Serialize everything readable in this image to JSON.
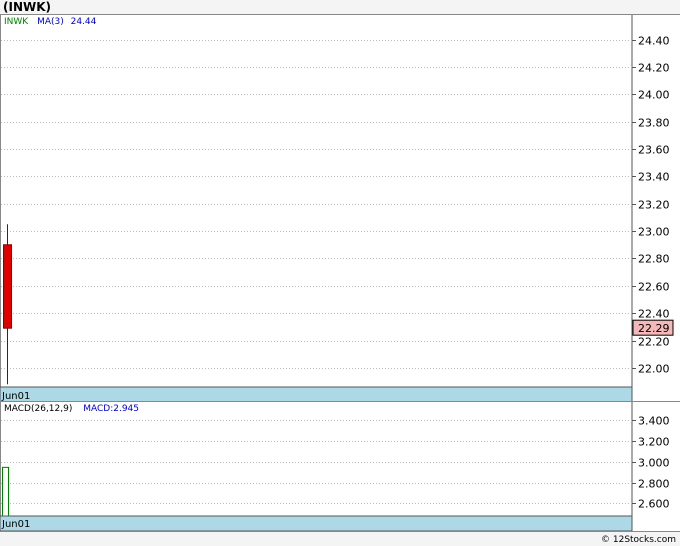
{
  "header": {
    "title": "(INWK)"
  },
  "price_panel": {
    "legend_symbol": "INWK",
    "legend_ma_label": "MA(3)",
    "legend_ma_value": "24.44",
    "last_price": "22.29",
    "date_label": "Jun01",
    "colors": {
      "down_candle": "#e00000",
      "price_badge": "#f4b8b8",
      "date_bar": "#add8e6",
      "grid": "#bbbbbb",
      "symbol": "#008000",
      "ma": "#0000cc"
    }
  },
  "macd_panel": {
    "legend_label": "MACD(26,12,9)",
    "legend_value": "MACD:2.945",
    "date_label": "Jun01",
    "colors": {
      "bar": "#008000",
      "value": "#0000cc"
    }
  },
  "footer": {
    "copyright": "© 12Stocks.com"
  },
  "chart_data": [
    {
      "type": "candlestick",
      "title": "(INWK)",
      "categories": [
        "Jun01"
      ],
      "series": [
        {
          "name": "INWK",
          "open": [
            22.9
          ],
          "high": [
            23.05
          ],
          "low": [
            21.88
          ],
          "close": [
            22.29
          ]
        }
      ],
      "ma_label": "MA(3)",
      "ma_value": 24.44,
      "last_value": 22.29,
      "yticks": [
        22.0,
        22.2,
        22.4,
        22.6,
        22.8,
        23.0,
        23.2,
        23.4,
        23.6,
        23.8,
        24.0,
        24.2,
        24.4
      ],
      "ytick_labels": [
        "22.00",
        "22.20",
        "22.40",
        "22.60",
        "22.80",
        "23.00",
        "23.20",
        "23.40",
        "23.60",
        "23.80",
        "24.00",
        "24.20",
        "24.40"
      ],
      "ylim": [
        21.86,
        24.58
      ],
      "grid": true
    },
    {
      "type": "bar",
      "title": "MACD(26,12,9)",
      "categories": [
        "Jun01"
      ],
      "series": [
        {
          "name": "MACD",
          "values": [
            2.945
          ]
        }
      ],
      "yticks": [
        2.6,
        2.8,
        3.0,
        3.2,
        3.4
      ],
      "ytick_labels": [
        "2.600",
        "2.800",
        "3.000",
        "3.200",
        "3.400"
      ],
      "ylim": [
        2.48,
        3.57
      ],
      "grid": true
    }
  ]
}
